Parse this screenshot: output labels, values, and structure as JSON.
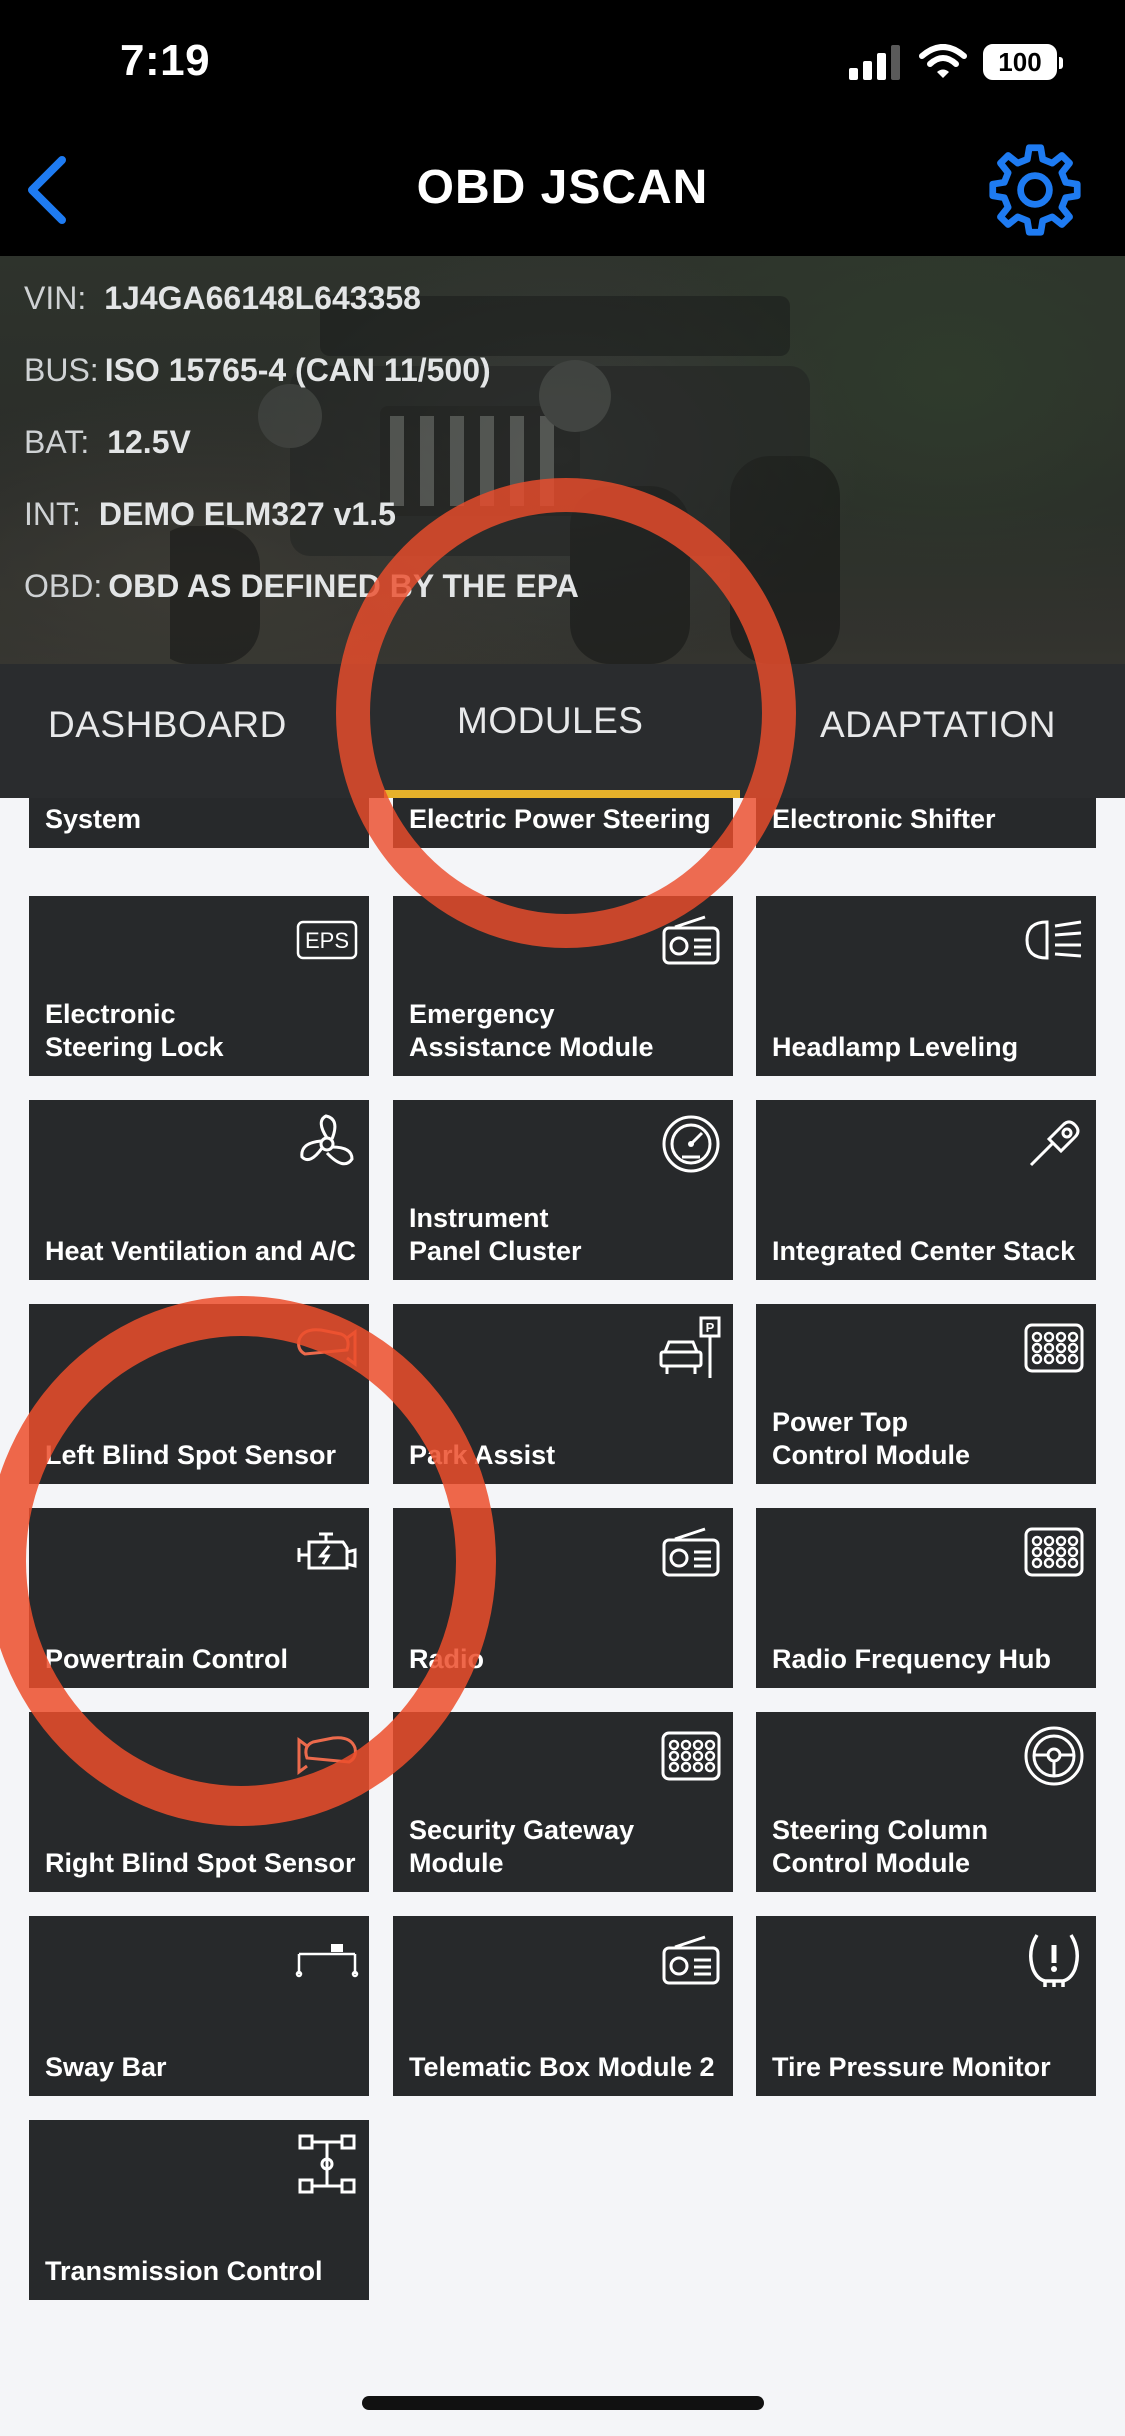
{
  "status_bar": {
    "time": "7:19",
    "battery": "100"
  },
  "nav": {
    "title": "OBD JSCAN",
    "back_icon": "chevron-left-icon",
    "settings_icon": "gear-icon",
    "accent": "#1e7bf2"
  },
  "vehicle_info": {
    "vin_label": "VIN:",
    "vin_value": "1J4GA66148L643358",
    "bus_label": "BUS:",
    "bus_value": "ISO 15765-4 (CAN 11/500)",
    "bat_label": "BAT:",
    "bat_value": "12.5V",
    "int_label": "INT:",
    "int_value": "DEMO ELM327 v1.5",
    "obd_label": "OBD:",
    "obd_value": "OBD AS DEFINED BY THE EPA"
  },
  "tabs": [
    {
      "label": "DASHBOARD"
    },
    {
      "label": "MODULES",
      "selected": true
    },
    {
      "label": "ADAPTATION"
    }
  ],
  "modules": [
    {
      "label": "Drivers Assistance System",
      "icon": "none"
    },
    {
      "label": "Electric Power Steering",
      "icon": "none"
    },
    {
      "label": "Electronic Shifter",
      "icon": "none"
    },
    {
      "label": "Electronic Steering Lock",
      "icon": "eps-icon",
      "icon_text": "EPS"
    },
    {
      "label": "Emergency Assistance Module",
      "icon": "radio-icon"
    },
    {
      "label": "Headlamp Leveling",
      "icon": "headlamp-icon"
    },
    {
      "label": "Heat Ventilation and A/C",
      "icon": "fan-icon"
    },
    {
      "label": "Instrument Panel Cluster",
      "icon": "gauge-icon"
    },
    {
      "label": "Integrated Center Stack",
      "icon": "key-fob-icon"
    },
    {
      "label": "Left Blind Spot Sensor",
      "icon": "mirror-icon"
    },
    {
      "label": "Park Assist",
      "icon": "parking-icon"
    },
    {
      "label": "Power Top Control Module",
      "icon": "module-chip-icon"
    },
    {
      "label": "Powertrain Control",
      "icon": "engine-icon"
    },
    {
      "label": "Radio",
      "icon": "radio-icon"
    },
    {
      "label": "Radio Frequency Hub",
      "icon": "module-chip-icon"
    },
    {
      "label": "Right Blind Spot Sensor",
      "icon": "mirror-icon"
    },
    {
      "label": "Security Gateway Module",
      "icon": "module-chip-icon"
    },
    {
      "label": "Steering Column Control Module",
      "icon": "steering-wheel-icon"
    },
    {
      "label": "Sway Bar",
      "icon": "sway-bar-icon"
    },
    {
      "label": "Telematic Box Module 2",
      "icon": "radio-icon"
    },
    {
      "label": "Tire Pressure Monitor",
      "icon": "tire-pressure-icon"
    },
    {
      "label": "Transmission Control",
      "icon": "transmission-icon"
    }
  ],
  "colors": {
    "tile_bg": "#27292b",
    "annotation_red": "#ec4d2c",
    "tab_indicator": "#e6b12a"
  }
}
